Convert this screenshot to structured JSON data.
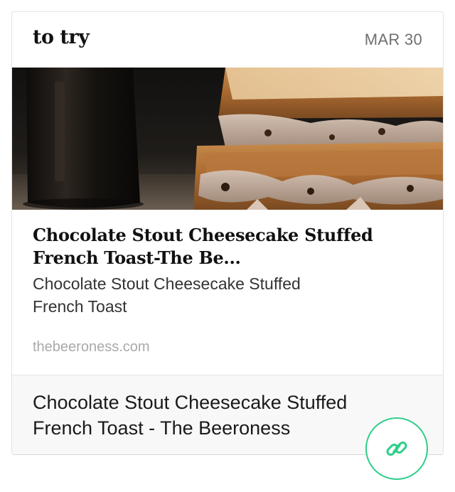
{
  "board": {
    "title": "to try",
    "date": "MAR 30"
  },
  "link": {
    "title": "Chocolate Stout Cheesecake Stuffed French Toast-The Be...",
    "description": "Chocolate Stout Cheesecake Stuffed French Toast",
    "domain": "thebeeroness.com",
    "image_icon": "food-photo"
  },
  "note": {
    "text": "Chocolate Stout Cheesecake Stuffed French Toast - The Beeroness"
  },
  "actions": {
    "link_icon": "chain-link-icon",
    "accent_color": "#2ecf8a"
  }
}
